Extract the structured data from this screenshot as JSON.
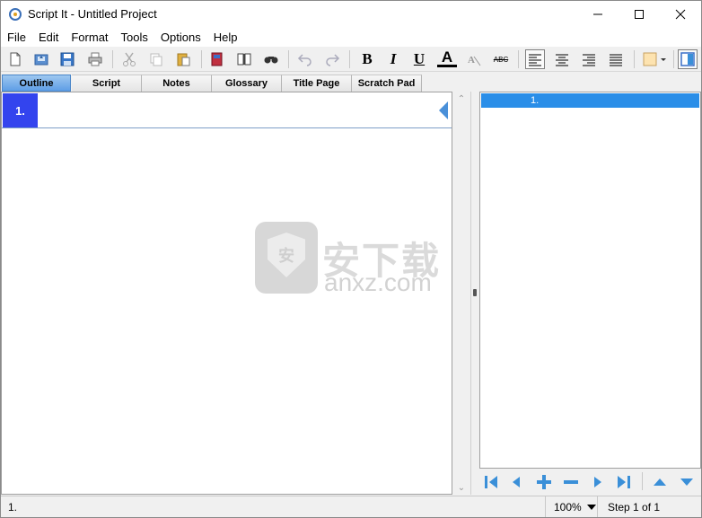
{
  "window": {
    "title": "Script It - Untitled Project",
    "buttons": {
      "minimize": "minimize-icon",
      "maximize": "maximize-icon",
      "close": "close-icon"
    }
  },
  "menu": [
    "File",
    "Edit",
    "Format",
    "Tools",
    "Options",
    "Help"
  ],
  "toolbar": {
    "icons": [
      "new-file-icon",
      "open-file-icon",
      "save-icon",
      "print-icon",
      "cut-icon",
      "copy-icon",
      "paste-icon",
      "spellcheck-icon",
      "book-icon",
      "find-icon",
      "undo-icon",
      "redo-icon",
      "bold-icon",
      "italic-icon",
      "underline-icon",
      "font-color-icon",
      "clear-format-icon",
      "strikethrough-icon",
      "align-left-icon",
      "align-center-icon",
      "align-right-icon",
      "justify-icon",
      "highlight-color-icon",
      "panel-toggle-icon"
    ],
    "bold_label": "B",
    "italic_label": "I",
    "underline_label": "U",
    "font_color_label": "A",
    "strike_label": "ABC",
    "highlight_color": "#fde3b0"
  },
  "tabs": [
    "Outline",
    "Script",
    "Notes",
    "Glossary",
    "Title Page",
    "Scratch Pad"
  ],
  "selected_tab": "Outline",
  "outline": {
    "number": "1."
  },
  "watermark": {
    "cn": "安下载",
    "en": "anxz.com",
    "shield": "安"
  },
  "right_panel": {
    "row_label": "1."
  },
  "navigation": {
    "icons": [
      "first-icon",
      "previous-icon",
      "add-icon",
      "remove-icon",
      "next-icon",
      "last-icon",
      "move-up-icon",
      "move-down-icon"
    ]
  },
  "status": {
    "left": "1.",
    "zoom": "100%",
    "step": "Step 1 of 1"
  },
  "colors": {
    "selected_tab": "#5e9ee6",
    "outline_number_bg": "#3344ee",
    "right_row_bg": "#2a8ee8",
    "nav_icon": "#3a8fd8"
  }
}
